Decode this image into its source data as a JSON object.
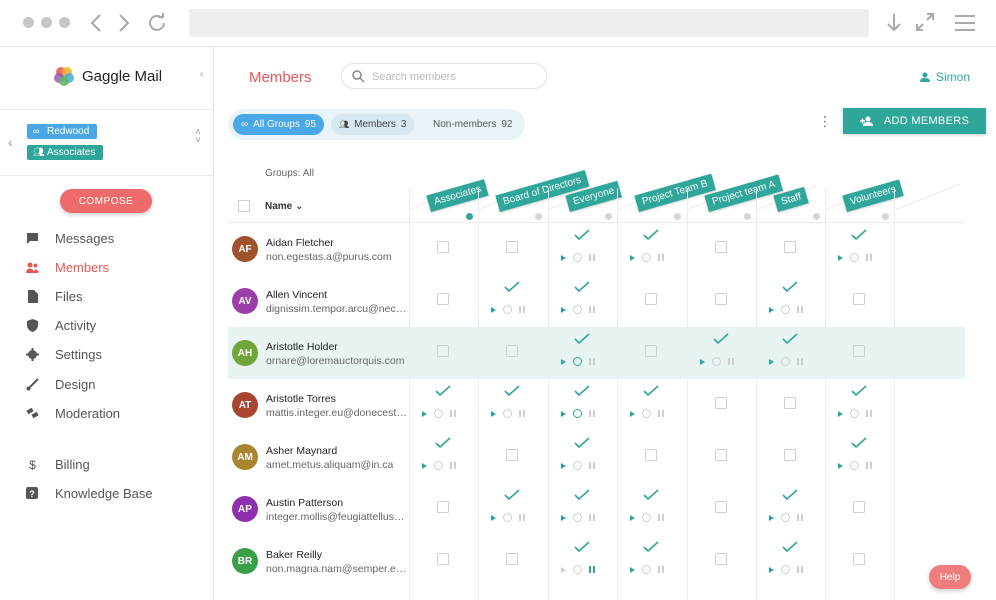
{
  "app": {
    "name": "Gaggle Mail"
  },
  "context": {
    "tags": [
      {
        "label": "Redwood",
        "icon": "link-icon",
        "color": "#4aa7e8"
      },
      {
        "label": "Associates",
        "icon": "people-icon",
        "color": "#2fa69a"
      }
    ]
  },
  "compose_label": "COMPOSE",
  "nav": [
    {
      "label": "Messages",
      "icon": "chat-icon",
      "active": false
    },
    {
      "label": "Members",
      "icon": "people-icon",
      "active": true
    },
    {
      "label": "Files",
      "icon": "file-icon",
      "active": false
    },
    {
      "label": "Activity",
      "icon": "shield-icon",
      "active": false
    },
    {
      "label": "Settings",
      "icon": "gear-icon",
      "active": false
    },
    {
      "label": "Design",
      "icon": "brush-icon",
      "active": false
    },
    {
      "label": "Moderation",
      "icon": "gavel-icon",
      "active": false
    },
    {
      "label": "Billing",
      "icon": "dollar-icon",
      "active": false
    },
    {
      "label": "Knowledge Base",
      "icon": "help-icon",
      "active": false
    }
  ],
  "header": {
    "title": "Members",
    "search_placeholder": "Search members",
    "user": "Simon"
  },
  "filters": [
    {
      "label": "All Groups",
      "count": "95",
      "active": true
    },
    {
      "label": "Members",
      "count": "3",
      "active": false
    },
    {
      "label": "Non-members",
      "count": "92",
      "active": false
    }
  ],
  "add_button_label": "ADD MEMBERS",
  "groups_label": "Groups: All",
  "name_column": "Name",
  "groups": [
    {
      "label": "Associates",
      "dot_on": true
    },
    {
      "label": "Board of Directors",
      "dot_on": false
    },
    {
      "label": "Everyone",
      "dot_on": false
    },
    {
      "label": "Project Team B",
      "dot_on": false
    },
    {
      "label": "Project team A",
      "dot_on": false
    },
    {
      "label": "Staff",
      "dot_on": false
    },
    {
      "label": "Volunteers",
      "dot_on": false
    }
  ],
  "members": [
    {
      "initials": "AF",
      "name": "Aidan Fletcher",
      "email": "non.egestas.a@purus.com",
      "color": "#a0522d",
      "highlight": false,
      "cells": [
        {
          "on": false
        },
        {
          "on": false
        },
        {
          "on": true,
          "active": ""
        },
        {
          "on": true,
          "active": ""
        },
        {
          "on": false
        },
        {
          "on": false
        },
        {
          "on": true,
          "active": ""
        }
      ]
    },
    {
      "initials": "AV",
      "name": "Allen Vincent",
      "email": "dignissim.tempor.arcu@nec…",
      "color": "#9b3fa6",
      "highlight": false,
      "cells": [
        {
          "on": false
        },
        {
          "on": true,
          "active": ""
        },
        {
          "on": true,
          "active": ""
        },
        {
          "on": false
        },
        {
          "on": false
        },
        {
          "on": true,
          "active": ""
        },
        {
          "on": false
        }
      ]
    },
    {
      "initials": "AH",
      "name": "Aristotle Holder",
      "email": "ornare@loremauctorquis.com",
      "color": "#6fa53a",
      "highlight": true,
      "cells": [
        {
          "on": false
        },
        {
          "on": false
        },
        {
          "on": true,
          "active": "clock"
        },
        {
          "on": false
        },
        {
          "on": true,
          "active": ""
        },
        {
          "on": true,
          "active": ""
        },
        {
          "on": false
        }
      ]
    },
    {
      "initials": "AT",
      "name": "Aristotle Torres",
      "email": "mattis.integer.eu@donecest…",
      "color": "#a84430",
      "highlight": false,
      "cells": [
        {
          "on": true,
          "active": ""
        },
        {
          "on": true,
          "active": ""
        },
        {
          "on": true,
          "active": "clock"
        },
        {
          "on": true,
          "active": ""
        },
        {
          "on": false
        },
        {
          "on": false
        },
        {
          "on": true,
          "active": ""
        }
      ]
    },
    {
      "initials": "AM",
      "name": "Asher Maynard",
      "email": "amet.metus.aliquam@in.ca",
      "color": "#a8862e",
      "highlight": false,
      "cells": [
        {
          "on": true,
          "active": ""
        },
        {
          "on": false
        },
        {
          "on": true,
          "active": ""
        },
        {
          "on": false
        },
        {
          "on": false
        },
        {
          "on": false
        },
        {
          "on": true,
          "active": ""
        }
      ]
    },
    {
      "initials": "AP",
      "name": "Austin Patterson",
      "email": "integer.mollis@feugiattellus…",
      "color": "#8e2fb0",
      "highlight": false,
      "cells": [
        {
          "on": false
        },
        {
          "on": true,
          "active": ""
        },
        {
          "on": true,
          "active": ""
        },
        {
          "on": true,
          "active": ""
        },
        {
          "on": false
        },
        {
          "on": true,
          "active": ""
        },
        {
          "on": false
        }
      ]
    },
    {
      "initials": "BR",
      "name": "Baker Reilly",
      "email": "non.magna.nam@semper.e…",
      "color": "#3aa047",
      "highlight": false,
      "cells": [
        {
          "on": false
        },
        {
          "on": false
        },
        {
          "on": true,
          "active": "pause"
        },
        {
          "on": true,
          "active": ""
        },
        {
          "on": false
        },
        {
          "on": true,
          "active": ""
        },
        {
          "on": false
        }
      ]
    }
  ],
  "help_label": "Help"
}
